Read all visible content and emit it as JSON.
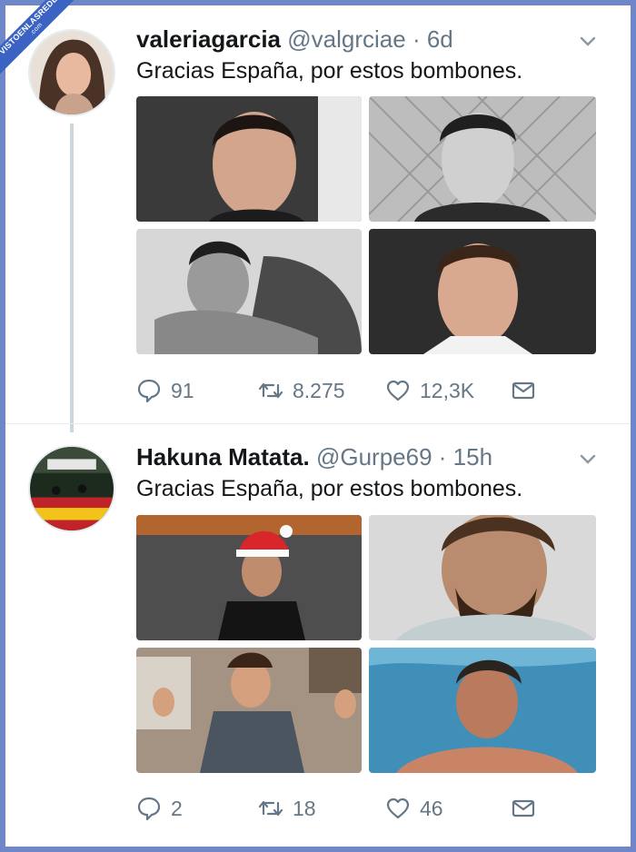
{
  "watermark": {
    "text": "VISTOENLASREDES",
    "domain": ".com"
  },
  "tweets": [
    {
      "name": "valeriagarcia",
      "handle": "@valgrciae",
      "time": "· 6d",
      "text": "Gracias España, por estos bombones.",
      "replies": "91",
      "retweets": "8.275",
      "likes": "12,3K"
    },
    {
      "name": "Hakuna Matata.",
      "handle": "@Gurpe69",
      "time": "· 15h",
      "text": "Gracias España, por estos bombones.",
      "replies": "2",
      "retweets": "18",
      "likes": "46"
    }
  ],
  "icons": {
    "reply": "speech-bubble-icon",
    "retweet": "retweet-arrows-icon",
    "like": "heart-icon",
    "dm": "envelope-icon",
    "menu": "chevron-down-icon"
  },
  "colors": {
    "frame": "#6f86c8",
    "ribbon": "#3b63c4",
    "muted": "#657786",
    "text": "#14171a"
  }
}
